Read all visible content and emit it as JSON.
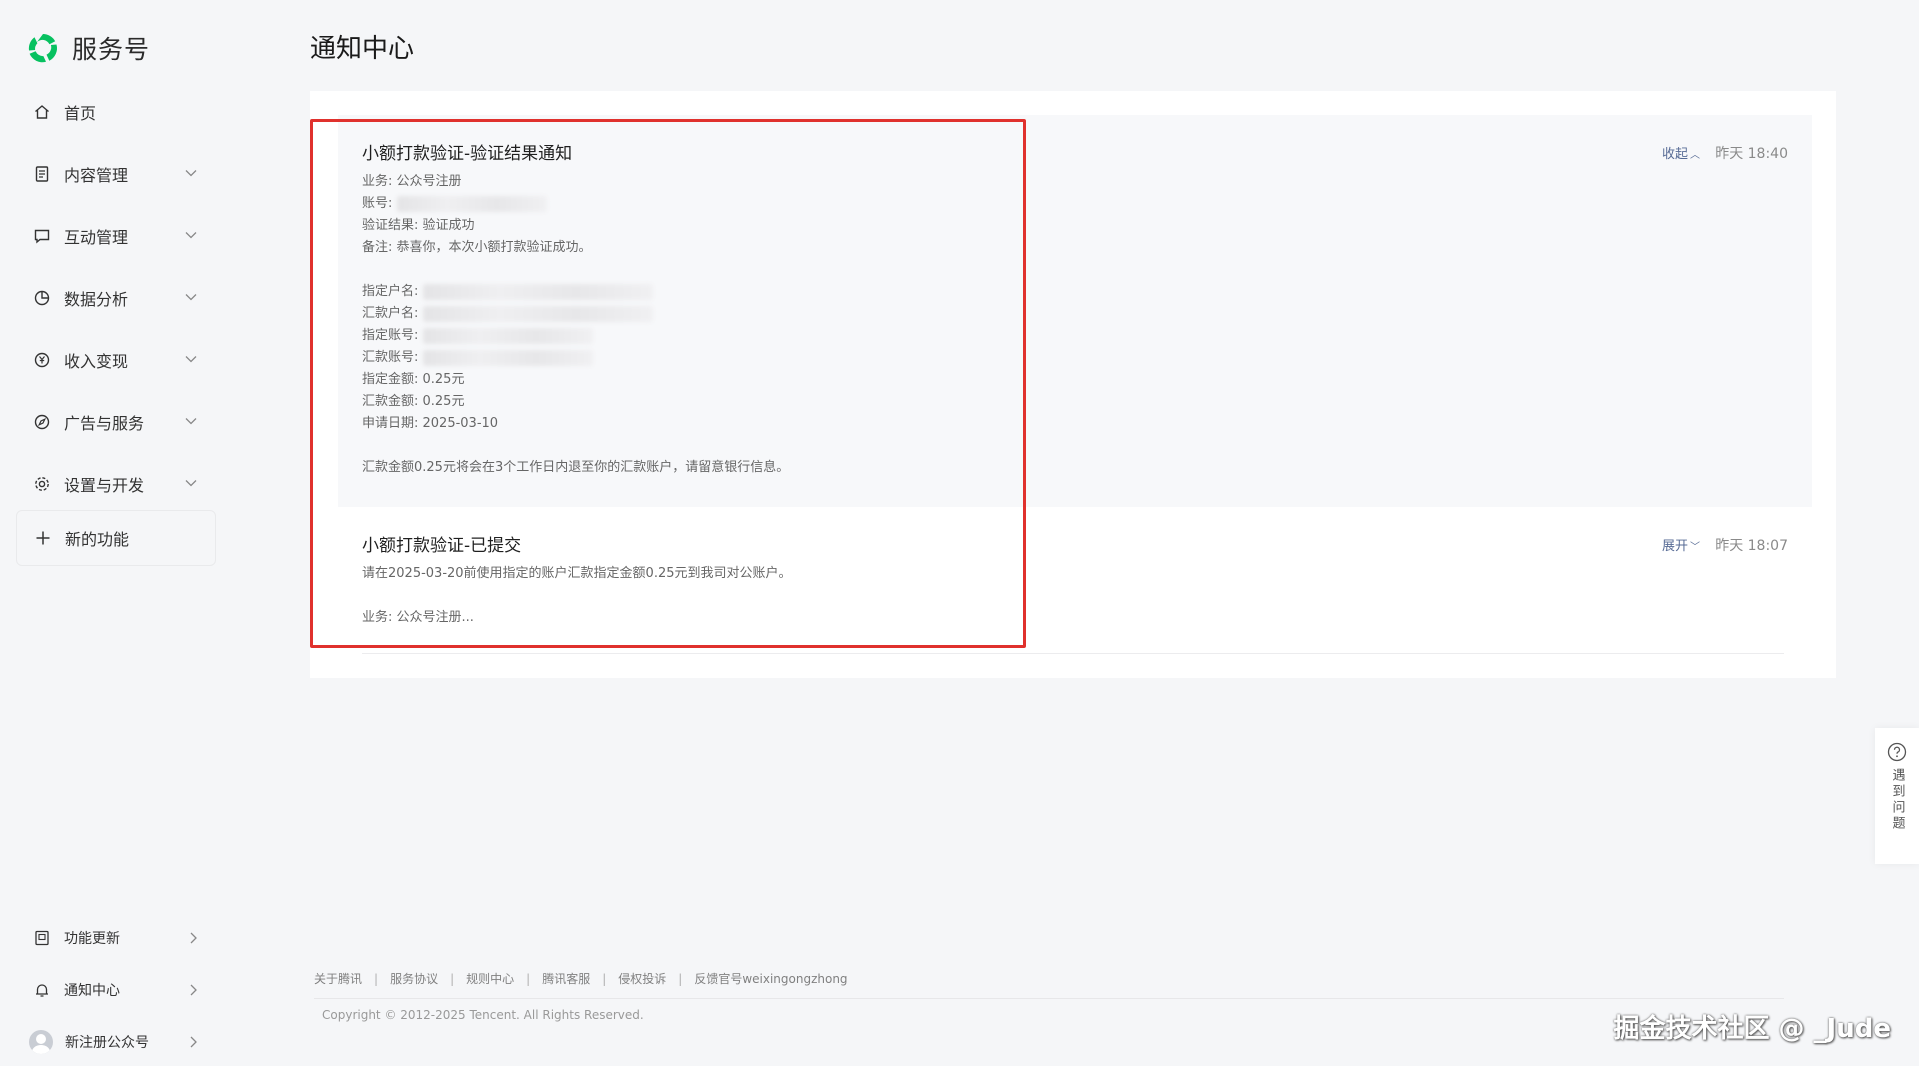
{
  "brand": {
    "name": "服务号",
    "accent": "#07c160"
  },
  "sidebar": {
    "items": [
      {
        "label": "首页",
        "icon": "home-icon"
      },
      {
        "label": "内容管理",
        "icon": "document-icon"
      },
      {
        "label": "互动管理",
        "icon": "chat-icon"
      },
      {
        "label": "数据分析",
        "icon": "pie-chart-icon"
      },
      {
        "label": "收入变现",
        "icon": "yen-coin-icon"
      },
      {
        "label": "广告与服务",
        "icon": "compass-icon"
      },
      {
        "label": "设置与开发",
        "icon": "gear-icon"
      }
    ],
    "new_feature": "新的功能",
    "bottom": [
      {
        "label": "功能更新",
        "icon": "update-icon"
      },
      {
        "label": "通知中心",
        "icon": "bell-icon"
      },
      {
        "label": "新注册公众号",
        "icon": "avatar"
      }
    ]
  },
  "page": {
    "title": "通知中心"
  },
  "messages": [
    {
      "title": "小额打款验证-验证结果通知",
      "action": "收起",
      "time": "昨天 18:40",
      "lines": {
        "business": "业务: 公众号注册",
        "account": "账号:",
        "result": "验证结果: 验证成功",
        "remark": "备注: 恭喜你，本次小额打款验证成功。",
        "designated_name": "指定户名:",
        "remit_name": "汇款户名:",
        "designated_account": "指定账号:",
        "remit_account": "汇款账号:",
        "designated_amount": "指定金额: 0.25元",
        "remit_amount": "汇款金额: 0.25元",
        "apply_date": "申请日期: 2025-03-10",
        "refund_note": "汇款金额0.25元将会在3个工作日内退至你的汇款账户，请留意银行信息。"
      }
    },
    {
      "title": "小额打款验证-已提交",
      "action": "展开",
      "time": "昨天 18:07",
      "lines": {
        "instruction": "请在2025-03-20前使用指定的账户汇款指定金额0.25元到我司对公账户。",
        "business": "业务: 公众号注册..."
      }
    }
  ],
  "footer": {
    "links": [
      "关于腾讯",
      "服务协议",
      "规则中心",
      "腾讯客服",
      "侵权投诉",
      "反馈官号weixingongzhong"
    ],
    "copyright": "Copyright © 2012-2025 Tencent. All Rights Reserved."
  },
  "help": {
    "label": "遇到问题",
    "icon": "question-icon"
  },
  "watermark": "掘金技术社区 @ _Jude",
  "colors": {
    "highlight": "#e0312d",
    "link": "#576b95",
    "background": "#f5f6f8"
  }
}
